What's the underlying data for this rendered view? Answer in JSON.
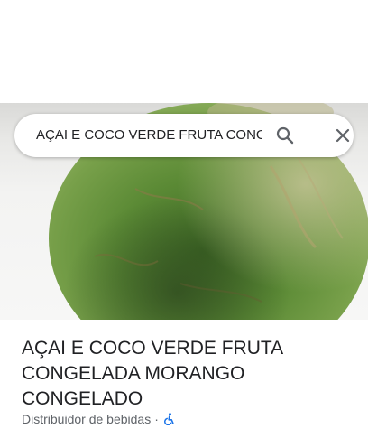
{
  "search": {
    "query": "AÇAI E COCO VERDE FRUTA CONGELADA MORANGO CONGELADO",
    "search_icon": "search-icon",
    "close_icon": "close-icon"
  },
  "hero": {
    "subject": "green coconut photo"
  },
  "place": {
    "title": "AÇAI E COCO VERDE FRUTA CONGELADA MORANGO CONGELADO",
    "category": "Distribuidor de bebidas",
    "separator": "·",
    "accessibility_icon": "wheelchair-accessible-icon"
  },
  "colors": {
    "accessibility_blue": "#1a73e8",
    "coconut_green": "#5f8a3a"
  }
}
